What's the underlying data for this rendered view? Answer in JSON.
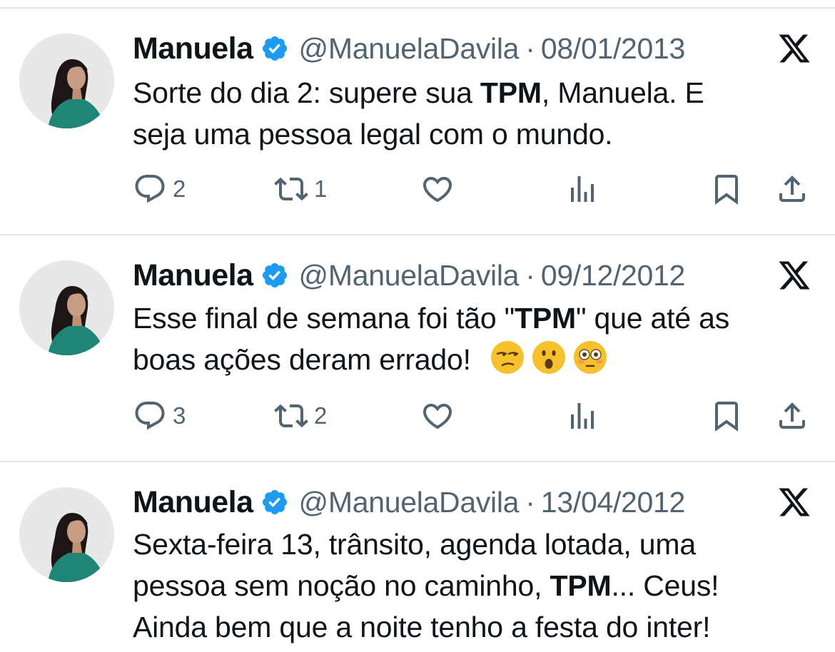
{
  "tweets": [
    {
      "name": "Manuela",
      "handle": "@ManuelaDavila",
      "separator": "·",
      "date": "08/01/2013",
      "text_line1": {
        "a": "Sorte do dia 2: supere sua ",
        "b": "TPM",
        "c": ", Manuela. E"
      },
      "text_line2": "seja uma pessoa legal com o mundo.",
      "replies": "2",
      "retweets": "1"
    },
    {
      "name": "Manuela",
      "handle": "@ManuelaDavila",
      "separator": "·",
      "date": "09/12/2012",
      "text_line1": {
        "a": "Esse final de semana foi tão \"",
        "b": "TPM",
        "c": "\" que até as"
      },
      "text_line2": "boas ações deram errado!",
      "emojis": [
        "unamused-face",
        "face-with-open-mouth",
        "flushed-face"
      ],
      "replies": "3",
      "retweets": "2"
    },
    {
      "name": "Manuela",
      "handle": "@ManuelaDavila",
      "separator": "·",
      "date": "13/04/2012",
      "text_line1": "Sexta-feira 13, trânsito, agenda lotada, uma",
      "text_line2": {
        "a": "pessoa sem noção no caminho, ",
        "b": "TPM",
        "c": "... Ceus!"
      },
      "text_line3": "Ainda bem que a noite tenho a festa do inter!"
    }
  ],
  "colors": {
    "text": "#0f1419",
    "secondary": "#536471",
    "verified": "#1d9bf0",
    "divider": "#e6e6e6"
  },
  "icons": [
    "reply-icon",
    "retweet-icon",
    "like-icon",
    "views-icon",
    "bookmark-icon",
    "share-icon",
    "x-logo-icon",
    "verified-badge-icon"
  ]
}
